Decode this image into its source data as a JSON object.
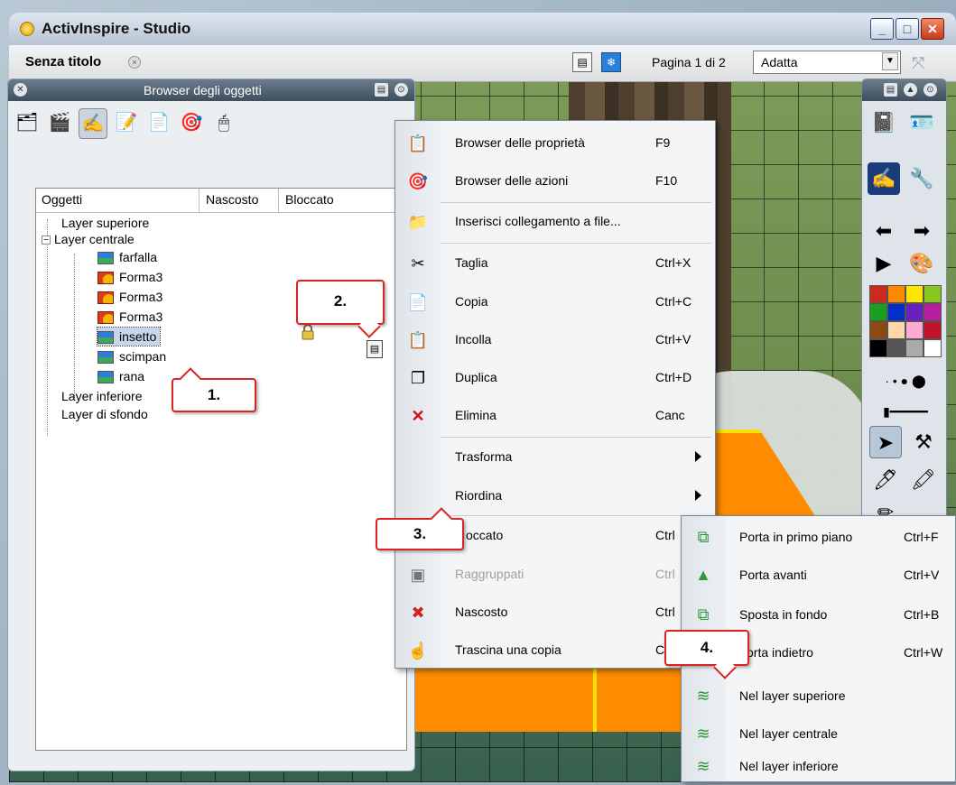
{
  "window": {
    "app_title": "ActivInspire - Studio",
    "min_label": "_",
    "max_label": "□",
    "close_label": "✕"
  },
  "toolbar": {
    "doc_tab": "Senza titolo",
    "tab_close": "×",
    "page_label": "Pagina 1 di 2",
    "zoom_value": "Adatta"
  },
  "object_browser": {
    "title": "Browser degli oggetti",
    "columns": [
      "Oggetti",
      "Nascosto",
      "Bloccato"
    ],
    "tree": [
      {
        "label": "Layer superiore"
      },
      {
        "label": "Layer centrale",
        "expander": "−"
      },
      {
        "label": "farfalla"
      },
      {
        "label": "Forma3"
      },
      {
        "label": "Forma3"
      },
      {
        "label": "Forma3"
      },
      {
        "label": "insetto"
      },
      {
        "label": "scimpan"
      },
      {
        "label": "rana"
      },
      {
        "label": "Layer inferiore"
      },
      {
        "label": "Layer di sfondo"
      }
    ]
  },
  "callouts": {
    "c1": "1.",
    "c2": "2.",
    "c3": "3.",
    "c4": "4."
  },
  "context_menu": [
    {
      "label": "Browser delle proprietà",
      "shortcut": "F9",
      "icon": "properties-browser-icon"
    },
    {
      "label": "Browser delle azioni",
      "shortcut": "F10",
      "icon": "actions-browser-icon"
    },
    {
      "label": "Inserisci collegamento a file...",
      "shortcut": "",
      "icon": "file-link-icon"
    },
    {
      "label": "Taglia",
      "shortcut": "Ctrl+X",
      "icon": "scissors-icon"
    },
    {
      "label": "Copia",
      "shortcut": "Ctrl+C",
      "icon": "copy-icon"
    },
    {
      "label": "Incolla",
      "shortcut": "Ctrl+V",
      "icon": "paste-icon"
    },
    {
      "label": "Duplica",
      "shortcut": "Ctrl+D",
      "icon": "duplicate-icon"
    },
    {
      "label": "Elimina",
      "shortcut": "Canc",
      "icon": "delete-icon"
    },
    {
      "label": "Trasforma",
      "shortcut": "",
      "icon": ""
    },
    {
      "label": "Riordina",
      "shortcut": "",
      "icon": ""
    },
    {
      "label": "occato",
      "shortcut": "Ctrl",
      "icon": ""
    },
    {
      "label": "Raggruppati",
      "shortcut": "Ctrl",
      "icon": "group-icon"
    },
    {
      "label": "Nascosto",
      "shortcut": "Ctrl",
      "icon": "hidden-icon"
    },
    {
      "label": "Trascina una copia",
      "shortcut": "C",
      "icon": "drag-copy-icon"
    }
  ],
  "submenu": [
    {
      "label": "Porta in primo piano",
      "shortcut": "Ctrl+F"
    },
    {
      "label": "Porta avanti",
      "shortcut": "Ctrl+V"
    },
    {
      "label": "Sposta in fondo",
      "shortcut": "Ctrl+B"
    },
    {
      "label": "orta indietro",
      "shortcut": "Ctrl+W"
    },
    {
      "label": "Nel layer superiore",
      "shortcut": ""
    },
    {
      "label": "Nel layer centrale",
      "shortcut": ""
    },
    {
      "label": "Nel layer inferiore",
      "shortcut": ""
    }
  ],
  "colors": {
    "swatches": [
      "#cc2a1e",
      "#ff8a00",
      "#ffe600",
      "#86c81e",
      "#1aa020",
      "#0030c8",
      "#6a1fc0",
      "#b71fa0",
      "#8a4a12",
      "#ffd7a8",
      "#ffaad4",
      "#c0142a",
      "#000000",
      "#555555",
      "#aaaaaa",
      "#ffffff"
    ]
  }
}
